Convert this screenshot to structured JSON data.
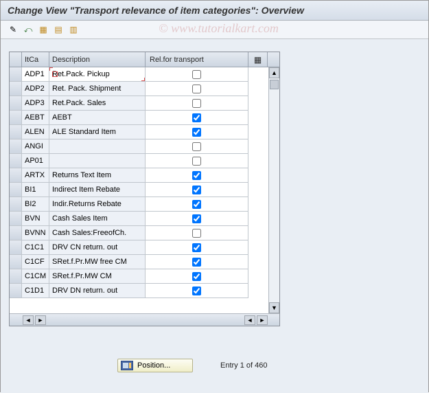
{
  "title": "Change View \"Transport relevance of item categories\": Overview",
  "watermark": "© www.tutorialkart.com",
  "headers": {
    "itca": "ItCa",
    "description": "Description",
    "rel": "Rel.for transport"
  },
  "rows": [
    {
      "itca": "ADP1",
      "desc": "Ret.Pack. Pickup",
      "rel": false
    },
    {
      "itca": "ADP2",
      "desc": "Ret. Pack. Shipment",
      "rel": false
    },
    {
      "itca": "ADP3",
      "desc": "Ret.Pack. Sales",
      "rel": false
    },
    {
      "itca": "AEBT",
      "desc": "AEBT",
      "rel": true
    },
    {
      "itca": "ALEN",
      "desc": "ALE Standard Item",
      "rel": true
    },
    {
      "itca": "ANGI",
      "desc": "",
      "rel": false
    },
    {
      "itca": "AP01",
      "desc": "",
      "rel": false
    },
    {
      "itca": "ARTX",
      "desc": "Returns Text Item",
      "rel": true
    },
    {
      "itca": "BI1",
      "desc": "Indirect Item Rebate",
      "rel": true
    },
    {
      "itca": "BI2",
      "desc": "Indir.Returns Rebate",
      "rel": true
    },
    {
      "itca": "BVN",
      "desc": "Cash Sales Item",
      "rel": true
    },
    {
      "itca": "BVNN",
      "desc": "Cash Sales:FreeofCh.",
      "rel": false
    },
    {
      "itca": "C1C1",
      "desc": "DRV CN return. out",
      "rel": true
    },
    {
      "itca": "C1CF",
      "desc": "SRet.f.Pr.MW free CM",
      "rel": true
    },
    {
      "itca": "C1CM",
      "desc": "SRet.f.Pr.MW CM",
      "rel": true
    },
    {
      "itca": "C1D1",
      "desc": "DRV DN return. out",
      "rel": true
    }
  ],
  "footer": {
    "position_label": "Position...",
    "entry_text": "Entry 1 of 460"
  }
}
